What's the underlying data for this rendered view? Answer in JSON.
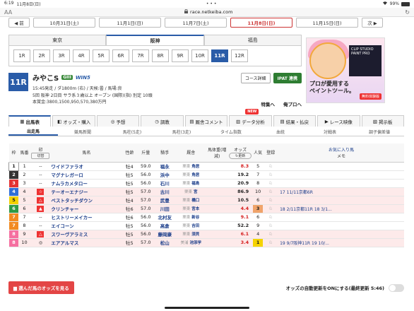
{
  "status": {
    "time": "6:19",
    "date": "11月8日(日)",
    "battery": "99%"
  },
  "browser": {
    "url": "race.netkeiba.com",
    "text_size": "AA"
  },
  "date_nav": {
    "prev": "◀ 前",
    "dates": [
      "10月31日(土)",
      "11月1日(日)",
      "11月7日(土)",
      "11月8日(日)",
      "11月15日(日)"
    ],
    "next": "次 ▶"
  },
  "venues": [
    "東京",
    "阪神",
    "福島"
  ],
  "races": [
    "1R",
    "2R",
    "3R",
    "4R",
    "5R",
    "6R",
    "7R",
    "8R",
    "9R",
    "10R",
    "11R",
    "12R"
  ],
  "race": {
    "number": "11R",
    "name": "みやこS",
    "grade": "GIII",
    "win5": "WIN5",
    "line1": "15:45発走 / ダ1800m (右) / 天候:曇 / 馬場:良",
    "line2": "5回 阪神 2日目 サラ系３歳以上 オープン (国際)(指) 別定 10頭",
    "line3": "本賞金:3800,1500,950,570,380万円",
    "btn_course": "コース詳細",
    "btn_ipat": "IPAT 連携",
    "link_special": "特集へ",
    "link_pro": "俺プロへ"
  },
  "ad": {
    "copy": "プロが愛用する\nペイントツール。",
    "product": "CLIP STUDIO PAINT PRO",
    "cta": "無料体験版"
  },
  "main_tabs": [
    "出馬表",
    "オッズ・購入",
    "予想",
    "調教",
    "厩舎コメント",
    "データ分析",
    "結果・払戻",
    "レース映像",
    "掲示板"
  ],
  "new_tag": "NEW",
  "sub_tabs": [
    "出走馬",
    "競馬新聞",
    "馬柱(5走)",
    "馬柱(3走)",
    "タイム指数",
    "血統",
    "対戦表",
    "調子偏差値"
  ],
  "headers": {
    "waku": "枠",
    "umaban": "馬番",
    "mark": "印",
    "mark_btn": "切替",
    "name": "馬名",
    "sex": "性齢",
    "kinryo": "斤量",
    "jockey": "騎手",
    "trainer": "厩舎",
    "weight": "馬体重(増減)",
    "odds": "オッズ",
    "update": "更新",
    "pop": "人気",
    "reg": "登録",
    "fav": "お気に入り馬",
    "memo": "メモ"
  },
  "colors": {
    "waku": [
      "#ffffff",
      "#333333",
      "#e33333",
      "#2f6fd8",
      "#f2d200",
      "#2e9a46",
      "#f28a20",
      "#f56fa0"
    ]
  },
  "horses": [
    {
      "waku": "1",
      "umaban": "1",
      "mark": "--",
      "name": "ワイドファラオ",
      "sex": "牡4",
      "kinryo": "59.0",
      "jockey": "福永",
      "region": "栗東",
      "trainer": "角居",
      "odds": "8.3",
      "pop": "5",
      "memo": ""
    },
    {
      "waku": "2",
      "umaban": "2",
      "mark": "--",
      "name": "マグナレガーロ",
      "sex": "牡5",
      "kinryo": "56.0",
      "jockey": "浜中",
      "region": "栗東",
      "trainer": "角居",
      "odds": "19.2",
      "pop": "7",
      "memo": ""
    },
    {
      "waku": "3",
      "umaban": "3",
      "mark": "--",
      "name": "ナムラカメタロー",
      "sex": "牡5",
      "kinryo": "56.0",
      "jockey": "石川",
      "region": "栗東",
      "trainer": "福島",
      "odds": "20.9",
      "pop": "8",
      "memo": ""
    },
    {
      "waku": "4",
      "umaban": "4",
      "mark": "☆",
      "name": "テーオーエナジー",
      "sex": "牡5",
      "kinryo": "57.0",
      "jockey": "古川",
      "region": "栗東",
      "trainer": "宮",
      "odds": "86.9",
      "pop": "10",
      "memo": "17 11/11京都6R"
    },
    {
      "waku": "5",
      "umaban": "5",
      "mark": "△",
      "name": "ベストタッチダウン",
      "sex": "牡4",
      "kinryo": "57.0",
      "jockey": "武豊",
      "region": "栗東",
      "trainer": "橋口",
      "odds": "10.5",
      "pop": "6",
      "memo": ""
    },
    {
      "waku": "6",
      "umaban": "6",
      "mark": "▲",
      "name": "クリンチャー",
      "sex": "牡6",
      "kinryo": "57.0",
      "jockey": "川田",
      "region": "栗東",
      "trainer": "宮本",
      "odds": "4.4",
      "pop": "3",
      "memo": "18 2/11京都11R 18 3/1..."
    },
    {
      "waku": "7",
      "umaban": "7",
      "mark": "--",
      "name": "ヒストリーメイカー",
      "sex": "牡6",
      "kinryo": "56.0",
      "jockey": "北村友",
      "region": "栗東",
      "trainer": "新谷",
      "odds": "9.1",
      "pop": "6",
      "memo": ""
    },
    {
      "waku": "7",
      "umaban": "8",
      "mark": "--",
      "name": "エイコーン",
      "sex": "牡5",
      "kinryo": "56.0",
      "jockey": "高倉",
      "region": "栗東",
      "trainer": "吉田",
      "odds": "52.2",
      "pop": "9",
      "memo": ""
    },
    {
      "waku": "8",
      "umaban": "9",
      "mark": "△",
      "name": "スワーヴアラミス",
      "sex": "牡5",
      "kinryo": "56.0",
      "jockey": "藤岡康",
      "region": "栗東",
      "trainer": "須貝",
      "odds": "6.1",
      "pop": "4",
      "memo": ""
    },
    {
      "waku": "8",
      "umaban": "10",
      "mark": "◎",
      "name": "エアアルマス",
      "sex": "牡5",
      "kinryo": "57.0",
      "jockey": "松山",
      "region": "美浦",
      "trainer": "池添学",
      "odds": "3.4",
      "pop": "1",
      "memo": "19 9/7阪神11R 19 10/..."
    }
  ],
  "bottom": {
    "odds_button": "選んだ馬のオッズを見る",
    "auto_update": "オッズの自動更新をONにする(最終更新 5:46)"
  }
}
